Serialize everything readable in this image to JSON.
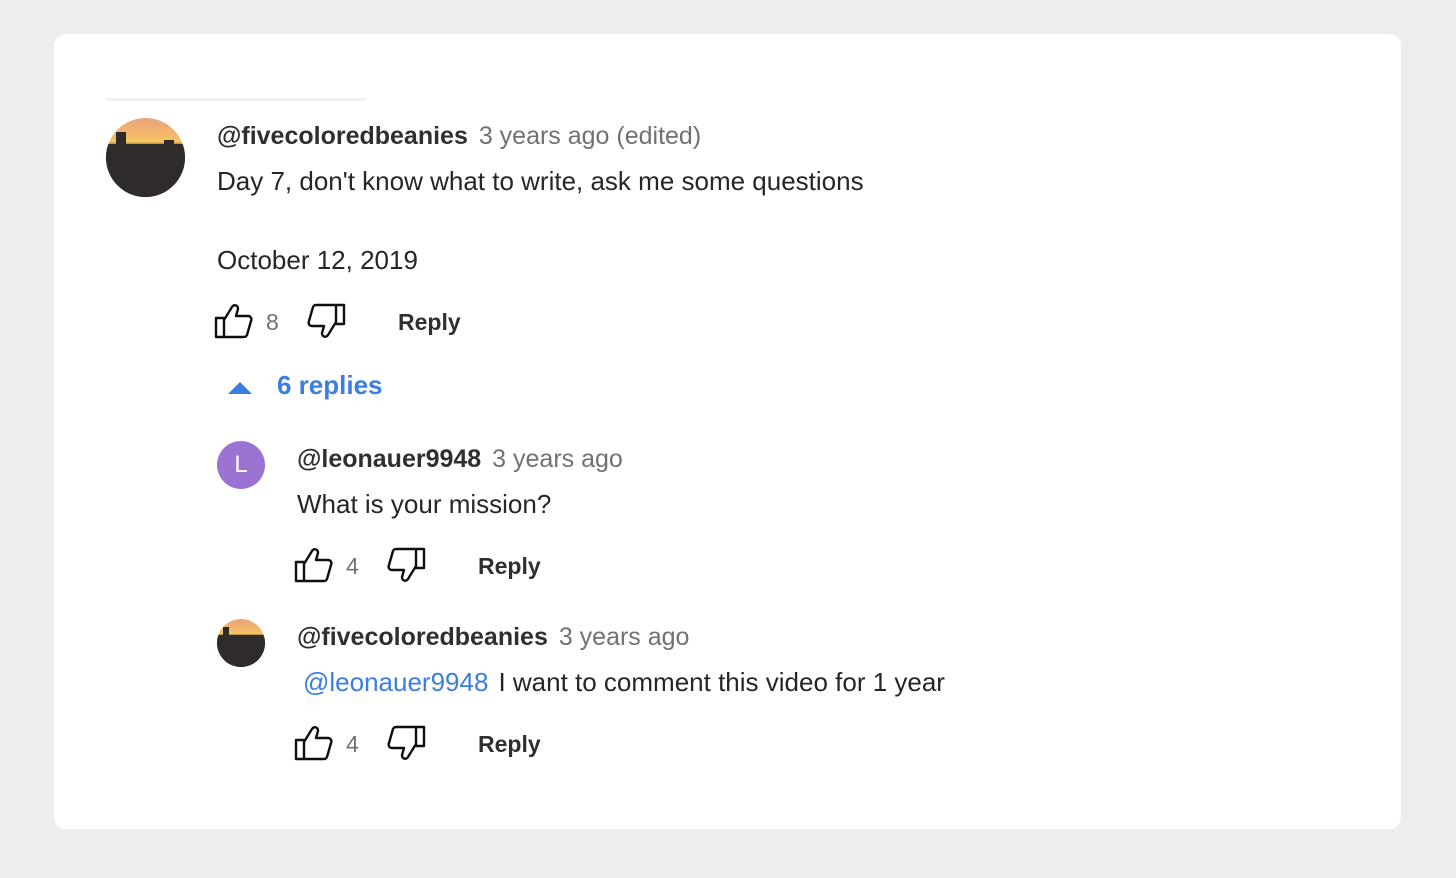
{
  "comment": {
    "author": "@fivecoloredbeanies",
    "time": "3 years ago (edited)",
    "text_line1": "Day 7, don't know what to write, ask me some questions",
    "text_line2": "October 12, 2019",
    "likes": "8",
    "reply_label": "Reply",
    "avatar_icon": "sunset-photo-avatar"
  },
  "replies_toggle": {
    "label": "6 replies",
    "icon": "caret-up-icon",
    "color": "#3b7ee0"
  },
  "replies": [
    {
      "author": "@leonauer9948",
      "time": "3 years ago",
      "avatar_letter": "L",
      "avatar_color": "#9a73d3",
      "text": "What is your mission?",
      "likes": "4",
      "reply_label": "Reply"
    },
    {
      "author": "@fivecoloredbeanies",
      "time": "3 years ago",
      "mention": "@leonauer9948",
      "text": "I want to comment this video for 1 year",
      "likes": "4",
      "reply_label": "Reply"
    }
  ]
}
